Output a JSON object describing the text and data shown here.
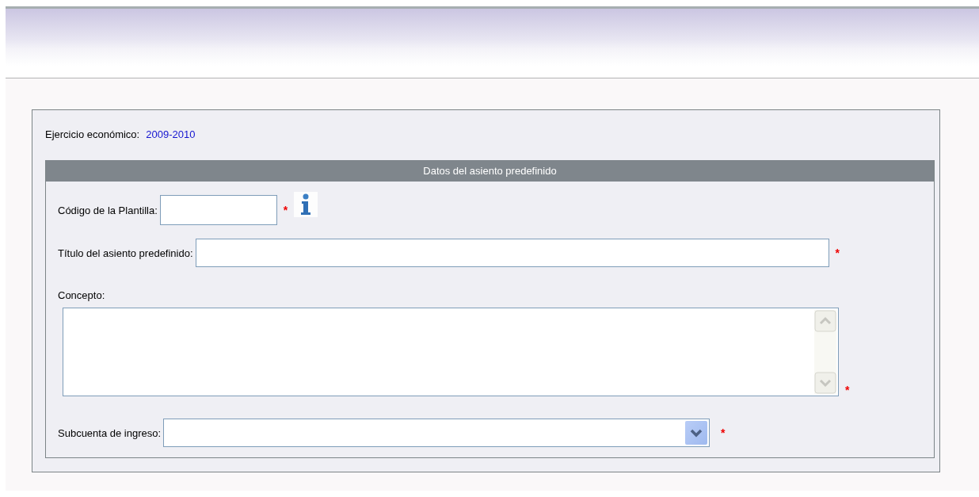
{
  "fiscal_year": {
    "label": "Ejercicio económico:",
    "value": "2009-2010"
  },
  "section": {
    "title": "Datos del asiento predefinido",
    "fields": [
      {
        "kind": "text",
        "label": "Código de la Plantilla:",
        "required_mark": "*",
        "info": true
      },
      {
        "kind": "text",
        "label": "Título del asiento predefinido:",
        "required_mark": "*",
        "info": false
      },
      {
        "kind": "textarea",
        "label": "Concepto:",
        "required_mark": "*",
        "info": false
      },
      {
        "kind": "select",
        "label": "Subcuenta de ingreso:",
        "required_mark": "*",
        "info": false
      }
    ]
  }
}
